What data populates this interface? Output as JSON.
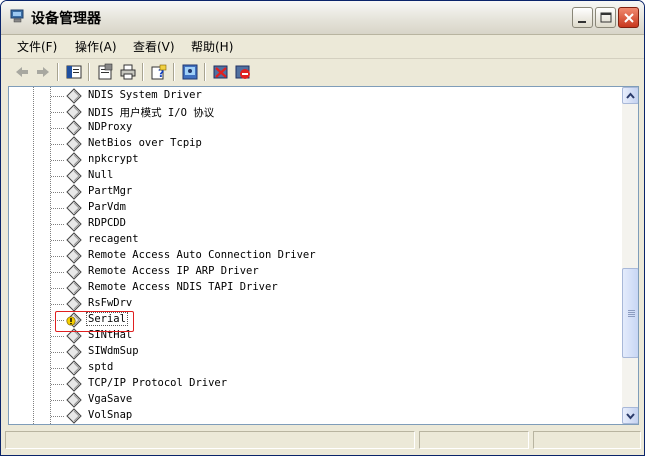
{
  "window": {
    "title": "设备管理器",
    "app_icon": "device-manager-icon"
  },
  "titlebar_buttons": [
    "minimize-icon",
    "maximize-icon",
    "close-icon"
  ],
  "menu": [
    {
      "label": "文件(F)"
    },
    {
      "label": "操作(A)"
    },
    {
      "label": "查看(V)"
    },
    {
      "label": "帮助(H)"
    }
  ],
  "toolbar": [
    "back-arrow-icon",
    "forward-arrow-icon",
    "show-hide-console-tree-icon",
    "properties-icon",
    "print-icon",
    "help-icon",
    "scan-hardware-icon",
    "uninstall-icon",
    "disable-icon"
  ],
  "tree": {
    "items": [
      {
        "label": "NDIS System Driver"
      },
      {
        "label": "NDIS 用户模式 I/O 协议"
      },
      {
        "label": "NDProxy"
      },
      {
        "label": "NetBios over Tcpip"
      },
      {
        "label": "npkcrypt"
      },
      {
        "label": "Null"
      },
      {
        "label": "PartMgr"
      },
      {
        "label": "ParVdm"
      },
      {
        "label": "RDPCDD"
      },
      {
        "label": "recagent"
      },
      {
        "label": "Remote Access Auto Connection Driver"
      },
      {
        "label": "Remote Access IP ARP Driver"
      },
      {
        "label": "Remote Access NDIS TAPI Driver"
      },
      {
        "label": "RsFwDrv"
      },
      {
        "label": "Serial",
        "warning": true,
        "selected": true
      },
      {
        "label": "SINtHal"
      },
      {
        "label": "SIWdmSup"
      },
      {
        "label": "sptd"
      },
      {
        "label": "TCP/IP Protocol Driver"
      },
      {
        "label": "VgaSave"
      },
      {
        "label": "VolSnap"
      }
    ]
  },
  "colors": {
    "title_bg": "#ECE9D8",
    "selection_outline": "#E02020",
    "warning": "#F5D000"
  }
}
